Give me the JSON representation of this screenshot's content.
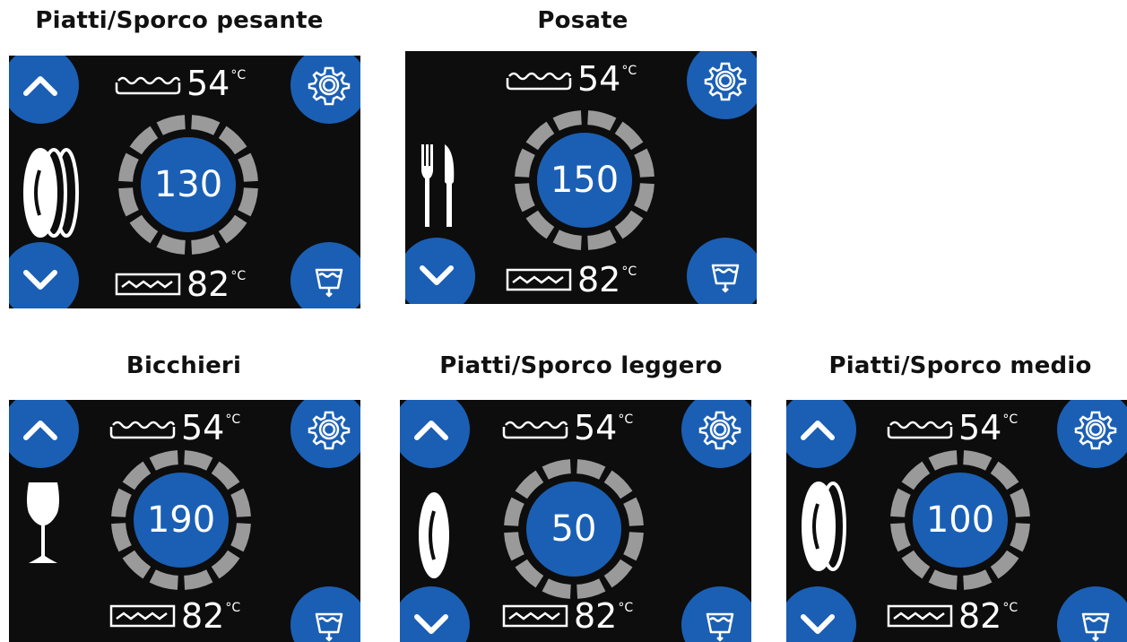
{
  "titles": {
    "heavy": "Piatti/Sporco pesante",
    "cutlery": "Posate",
    "glasses": "Bicchieri",
    "light": "Piatti/Sporco leggero",
    "medium": "Piatti/Sporco medio"
  },
  "panels": {
    "heavy": {
      "wash_temp": "54",
      "rinse_temp": "82",
      "unit": "°C",
      "time": "130",
      "icon": "plates-triple-icon"
    },
    "cutlery": {
      "wash_temp": "54",
      "rinse_temp": "82",
      "unit": "°C",
      "time": "150",
      "icon": "fork-knife-icon"
    },
    "glasses": {
      "wash_temp": "54",
      "rinse_temp": "82",
      "unit": "°C",
      "time": "190",
      "icon": "wine-glass-icon"
    },
    "light": {
      "wash_temp": "54",
      "rinse_temp": "82",
      "unit": "°C",
      "time": "50",
      "icon": "plate-single-icon"
    },
    "medium": {
      "wash_temp": "54",
      "rinse_temp": "82",
      "unit": "°C",
      "time": "100",
      "icon": "plates-double-icon"
    }
  },
  "colors": {
    "accent": "#1a5fb4",
    "screen_bg": "#0d0d0d",
    "segment": "#9a9a9a"
  }
}
